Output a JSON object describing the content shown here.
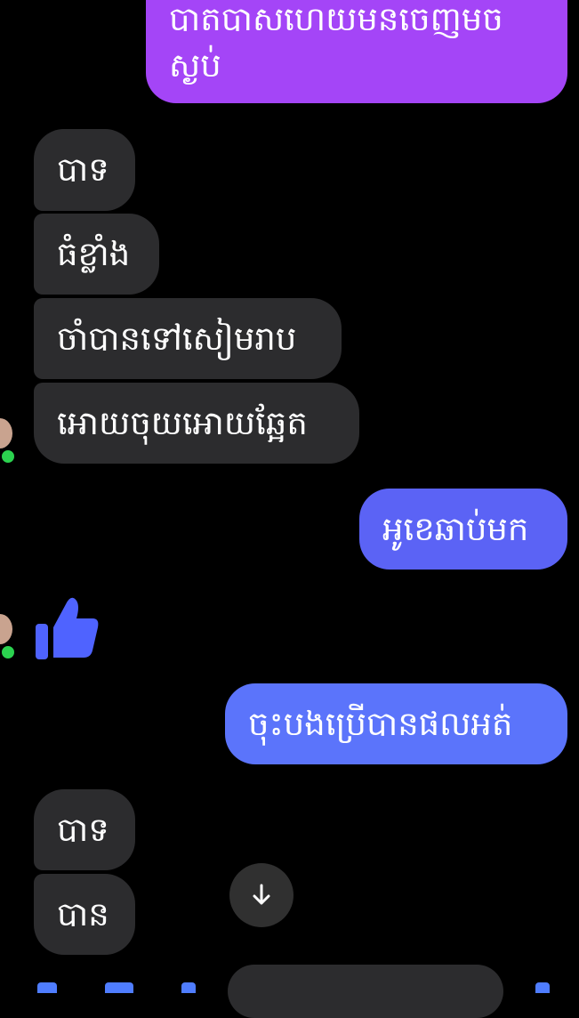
{
  "messages": {
    "m1": "បាតបាសហេយមនចេញមច\nស្ងប់",
    "m2": "បាទ",
    "m3": "ធំខ្លាំង",
    "m4": "ចាំបានទៅសៀមរាប",
    "m5": "អោយចុយអោយឆ្អែត",
    "m6": "អូខេឆាប់មក",
    "m7": "👍",
    "m8": "ចុះបងប្រើបានផលអត់",
    "m9": "បាទ",
    "m10": "បាន"
  },
  "icons": {
    "thumbs_up": "thumbs-up-icon",
    "scroll_down": "arrow-down-icon"
  },
  "colors": {
    "incoming": "#2c2c2e",
    "outgoing_purple": "#a445f7",
    "outgoing_blue": "#5b63f5",
    "outgoing_blue_2": "#5b74fb",
    "online_dot": "#2bd24f",
    "thumb_blue": "#4f63ff"
  }
}
